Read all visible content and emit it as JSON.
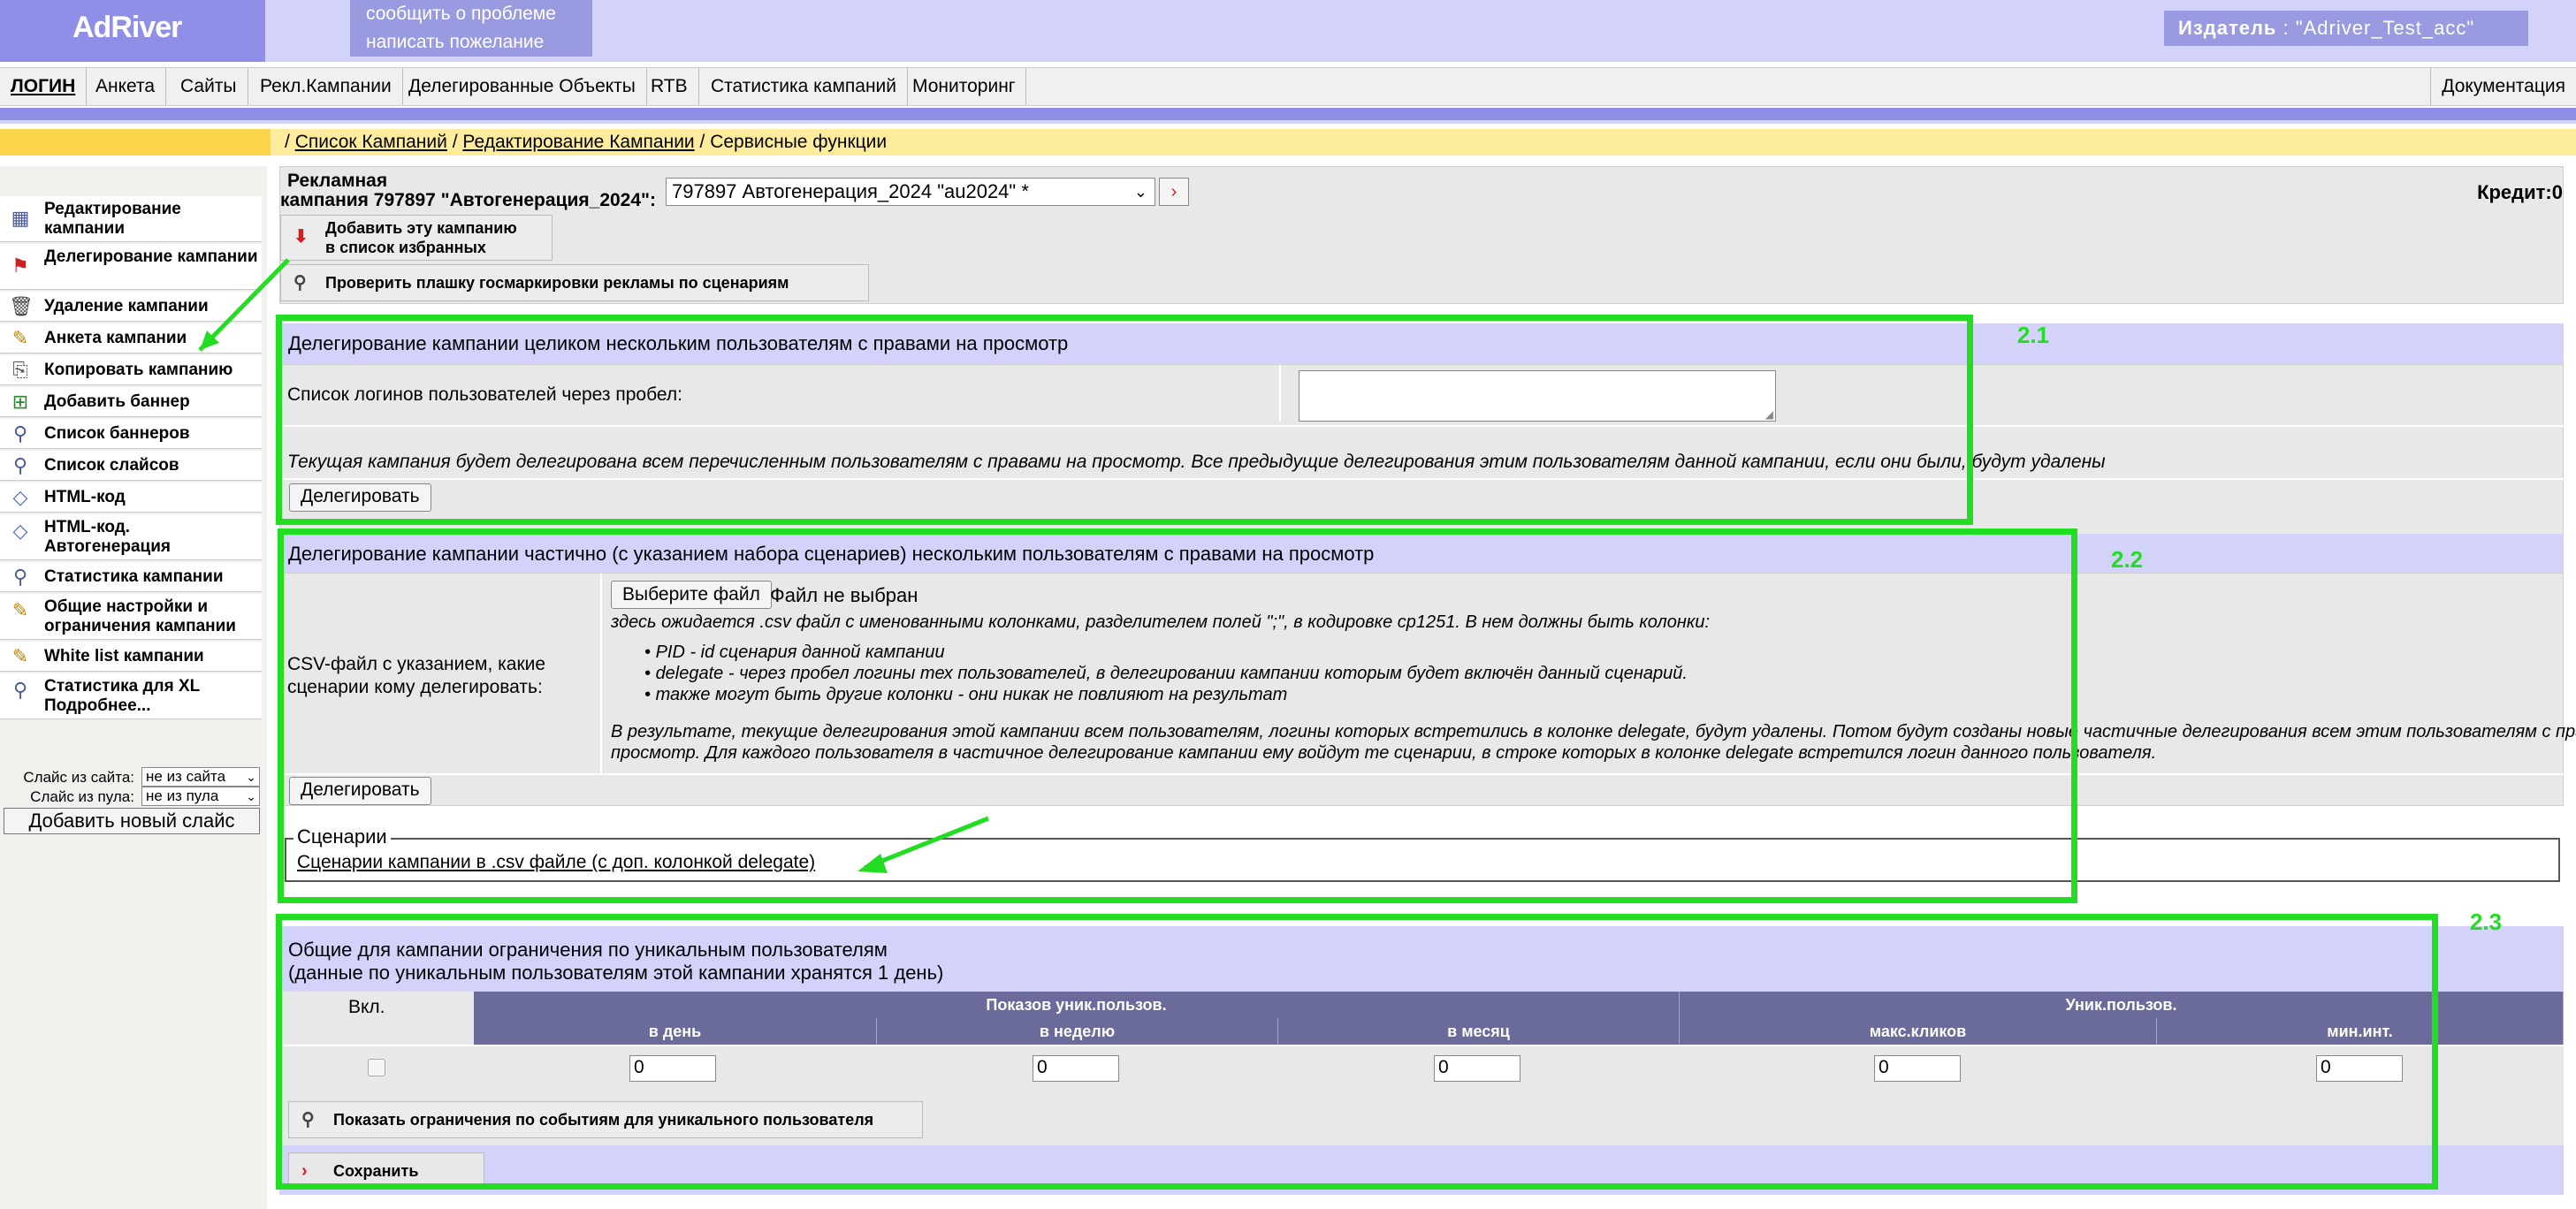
{
  "header": {
    "logo": "AdRiver",
    "report_problem": "сообщить о проблеме",
    "write_wish": "написать пожелание",
    "publisher_label": "Издатель",
    "publisher_value": ": \"Adriver_Test_acc\""
  },
  "menu": {
    "items": [
      "ЛОГИН",
      "Анкета",
      "Сайты",
      "Рекл.Кампании",
      "Делегированные Объекты",
      "RTB",
      "Статистика кампаний",
      "Мониторинг"
    ],
    "documentation": "Документация"
  },
  "breadcrumb": {
    "sep": "/",
    "link1": "Список Кампаний",
    "link2": "Редактирование Кампании",
    "current": "Сервисные функции"
  },
  "sidebar": {
    "items": [
      {
        "label": "Редактирование кампании",
        "icon": "grid-icon"
      },
      {
        "label": "Делегирование кампании",
        "icon": "flag-icon"
      },
      {
        "label": "Удаление кампании",
        "icon": "trash-icon"
      },
      {
        "label": "Анкета кампании",
        "icon": "pencil-icon"
      },
      {
        "label": "Копировать кампанию",
        "icon": "copy-icon"
      },
      {
        "label": "Добавить баннер",
        "icon": "add-banner-icon"
      },
      {
        "label": "Список баннеров",
        "icon": "magnifier-icon"
      },
      {
        "label": "Список слайсов",
        "icon": "magnifier-icon"
      },
      {
        "label": "HTML-код",
        "icon": "code-icon"
      },
      {
        "label": "HTML-код. Автогенерация",
        "icon": "code-icon"
      },
      {
        "label": "Статистика кампании",
        "icon": "magnifier-icon"
      },
      {
        "label": "Общие настройки и ограничения кампании",
        "icon": "pencil-icon"
      },
      {
        "label": "White list кампании",
        "icon": "pencil-icon"
      },
      {
        "label": "Статистика для XL Подробнее...",
        "icon": "magnifier-icon"
      }
    ],
    "slice_from_site_label": "Слайс из сайта:",
    "slice_from_site_value": "не из сайта",
    "slice_from_pool_label": "Слайс из пула:",
    "slice_from_pool_value": "не из пула",
    "add_slice_button": "Добавить новый слайс"
  },
  "campaign": {
    "title_line1": "Рекламная",
    "title_line2": "кампания 797897 \"Автогенерация_2024\":",
    "select_value": "797897 Автогенерация_2024 \"au2024\" *",
    "credit": "Кредит:0",
    "add_favorite_line1": "Добавить эту кампанию",
    "add_favorite_line2": "в список избранных",
    "check_label_button": "Проверить плашку госмаркировки рекламы по сценариям"
  },
  "section21": {
    "tag": "2.1",
    "title": "Делегирование кампании целиком нескольким пользователям с правами на просмотр",
    "logins_label": "Список логинов пользователей через пробел:",
    "logins_value": "",
    "note": "Текущая кампания будет делегирована всем перечисленным пользователям с правами на просмотр. Все предыдущие делегирования этим пользователям данной кампании, если они были, будут удалены",
    "delegate_button": "Делегировать"
  },
  "section22": {
    "tag": "2.2",
    "title": "Делегирование кампании частично (с указанием набора сценариев) нескольким пользователям с правами на просмотр",
    "csv_label_line1": "CSV-файл с указанием, какие",
    "csv_label_line2": "сценарии кому делегировать:",
    "choose_file_button": "Выберите файл",
    "no_file": "Файл не выбран",
    "expect_text": "здесь ожидается .csv файл с именованными колонками, разделителем полей \";\", в кодировке cp1251. В нем должны быть колонки:",
    "bullets": [
      "PID - id сценария данной кампании",
      "delegate - через пробел логины тех пользователей, в делегировании кампании которым будет включён данный сценарий.",
      "также могут быть другие колонки - они никак не повлияют на результат"
    ],
    "result_line1": "В результате, текущие делегирования этой кампании всем пользователям, логины которых встретились в колонке delegate, будут удалены. Потом будут созданы новые частичные делегирования всем этим пользователям с правами на",
    "result_line2": "просмотр. Для каждого пользователя в частичное делегирование кампании ему войдут те сценарии, в строке которых в колонке delegate встретился логин данного пользователя.",
    "delegate_button": "Делегировать",
    "scenarios_legend": "Сценарии",
    "scenarios_link": "Сценарии кампании в .csv файле (с доп. колонкой delegate)"
  },
  "section23": {
    "tag": "2.3",
    "title_line1": "Общие для кампании ограничения по уникальным пользователям",
    "title_line2": "(данные по уникальным пользователям этой кампании хранятся 1 день)",
    "col_enabled": "Вкл.",
    "group_impressions": "Показов уник.пользов.",
    "group_unique": "Уник.пользов.",
    "col_day": "в день",
    "col_week": "в неделю",
    "col_month": "в месяц",
    "col_max_clicks": "макс.кликов",
    "col_min_int": "мин.инт.",
    "val_day": "0",
    "val_week": "0",
    "val_month": "0",
    "val_max_clicks": "0",
    "val_min_int": "0",
    "show_events_button": "Показать ограничения по событиям для уникального пользователя",
    "save_button": "Сохранить"
  },
  "colors": {
    "lavender": "#d2d2fb",
    "blue": "#8f8fe8",
    "yellow": "#fbd44a",
    "highlight_green": "#22dd22",
    "table_header": "#6b6b9b"
  }
}
